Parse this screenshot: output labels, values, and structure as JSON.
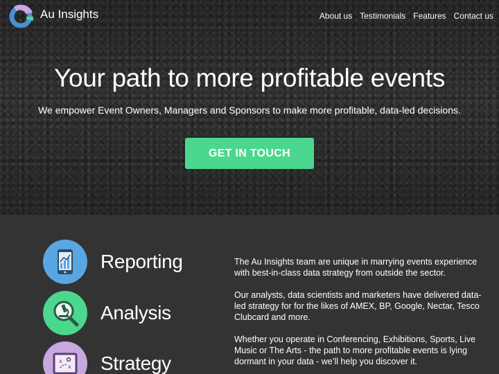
{
  "brand": {
    "name": "Au Insights",
    "logo_colors": {
      "ring": "#4a8fd4",
      "top": "#c9a7e0",
      "bottom": "#4cd78e"
    }
  },
  "nav": {
    "links": [
      "About us",
      "Testimonials",
      "Features",
      "Contact us"
    ]
  },
  "hero": {
    "title": "Your path to more profitable events",
    "subtitle": "We empower Event Owners, Managers and Sponsors to make more profitable, data-led decisions.",
    "cta_label": "GET IN TOUCH"
  },
  "features": [
    {
      "label": "Reporting",
      "icon": "tablet-chart-icon",
      "color": "#5aa6e3"
    },
    {
      "label": "Analysis",
      "icon": "microscope-icon",
      "color": "#4cd78e"
    },
    {
      "label": "Strategy",
      "icon": "strategy-board-icon",
      "color": "#c9a7e0"
    }
  ],
  "about": {
    "paragraphs": [
      "The Au Insights team are unique in marrying events experience with best-in-class data strategy from outside the sector.",
      "Our analysts, data scientists and marketers have delivered data-led strategy for for the likes of AMEX, BP, Google, Nectar, Tesco Clubcard and more.",
      "Whether you operate in Conferencing, Exhibitions, Sports, Live Music or The Arts - the path to more profitable events is lying dormant in your data - we’ll help you discover it."
    ]
  },
  "colors": {
    "accent_green": "#4cd78e",
    "section_bg": "#333333"
  }
}
